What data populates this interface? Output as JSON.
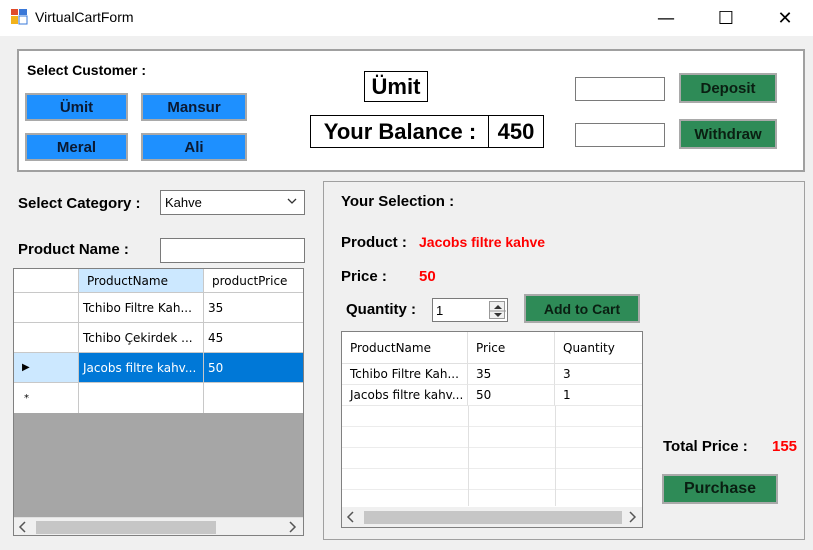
{
  "window": {
    "title": "VirtualCartForm",
    "minimize": "—",
    "maximize": "☐",
    "close": "✕"
  },
  "customer": {
    "label": "Select Customer :",
    "buttons": [
      "Ümit",
      "Mansur",
      "Meral",
      "Ali"
    ],
    "selected_name": "Ümit",
    "balance_label": "Your Balance :",
    "balance": "450"
  },
  "account": {
    "deposit_value": "",
    "withdraw_value": "",
    "deposit_label": "Deposit",
    "withdraw_label": "Withdraw"
  },
  "category": {
    "label": "Select Category :",
    "value": "Kahve"
  },
  "product_search": {
    "label": "Product Name :",
    "value": ""
  },
  "product_grid": {
    "headers": [
      "ProductName",
      "productPrice"
    ],
    "rows": [
      [
        "Tchibo Filtre Kah...",
        "35"
      ],
      [
        "Tchibo Çekirdek ...",
        "45"
      ],
      [
        "Jacobs filtre kahv...",
        "50"
      ]
    ],
    "selected_row_marker": "▶",
    "new_row_marker": "*"
  },
  "selection": {
    "heading": "Your Selection :",
    "product_label": "Product :",
    "product_value": "Jacobs filtre kahve",
    "price_label": "Price :",
    "price_value": "50",
    "quantity_label": "Quantity :",
    "quantity_value": "1",
    "add_to_cart_label": "Add to Cart"
  },
  "cart_grid": {
    "headers": [
      "ProductName",
      "Price",
      "Quantity"
    ],
    "rows": [
      [
        "Tchibo Filtre Kah...",
        "35",
        "3"
      ],
      [
        "Jacobs filtre kahv...",
        "50",
        "1"
      ]
    ]
  },
  "total": {
    "label": "Total Price :",
    "value": "155"
  },
  "purchase_label": "Purchase",
  "colors": {
    "button_blue": "#1e90ff",
    "button_green": "#2e8b57",
    "selection_blue": "#0078d7",
    "price_red": "#ff0000"
  }
}
